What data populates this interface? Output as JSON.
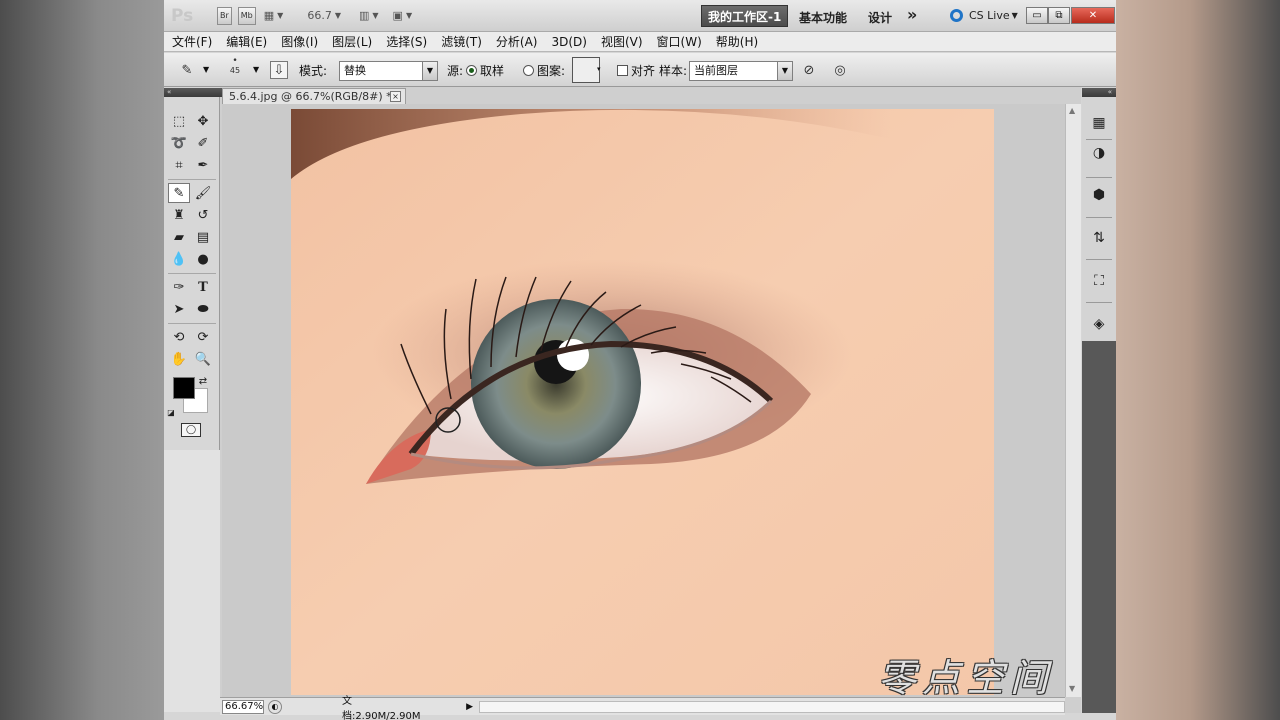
{
  "app": {
    "logo": "Ps",
    "bridge_label": "Br",
    "minibridge_label": "Mb",
    "zoom_value": "66.7",
    "workspaces": {
      "active": "我的工作区-1",
      "essentials": "基本功能",
      "design": "设计",
      "more": "»"
    },
    "cslive_label": "CS Live",
    "window_buttons": {
      "minimize": "▭",
      "restore": "⧉",
      "close": "✕"
    }
  },
  "menu": [
    "文件(F)",
    "编辑(E)",
    "图像(I)",
    "图层(L)",
    "选择(S)",
    "滤镜(T)",
    "分析(A)",
    "3D(D)",
    "视图(V)",
    "窗口(W)",
    "帮助(H)"
  ],
  "options": {
    "brush_size": "45",
    "mode_label": "模式:",
    "mode_value": "替换",
    "source_label": "源:",
    "sampled_label": "取样",
    "pattern_label": "图案:",
    "aligned_label": "对齐",
    "sample_label": "样本:",
    "sample_value": "当前图层"
  },
  "document": {
    "tab_title": "5.6.4.jpg @ 66.7%(RGB/8#) *",
    "tab_close": "×",
    "status_zoom": "66.67%",
    "status_docinfo": "文档:2.90M/2.90M",
    "status_arrow": "▶"
  },
  "watermark": "零点空间",
  "colors": {
    "foreground": "#000000",
    "background": "#ffffff",
    "active_workspace": "#5a5a5a",
    "close_button": "#c8392a"
  }
}
